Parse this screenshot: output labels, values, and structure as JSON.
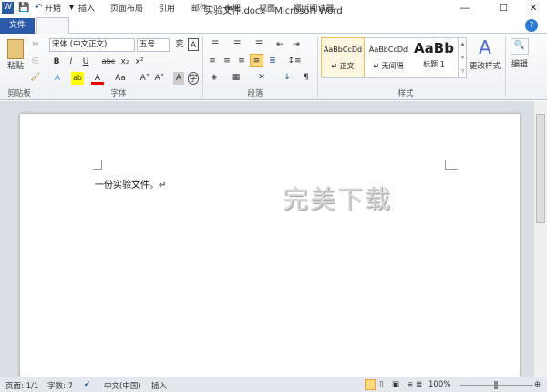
{
  "window": {
    "title": "实验文件.docx - Microsoft Word",
    "minimize": "—",
    "maximize": "☐",
    "close": "✕"
  },
  "quick_access": {
    "save": "💾",
    "undo": "↶",
    "redo": "↺",
    "customize": "▾"
  },
  "tabs": [
    {
      "label": "文件"
    },
    {
      "label": "开始"
    },
    {
      "label": "插入"
    },
    {
      "label": "页面布局"
    },
    {
      "label": "引用"
    },
    {
      "label": "邮件"
    },
    {
      "label": "审阅"
    },
    {
      "label": "视图"
    },
    {
      "label": "福昕阅读器"
    }
  ],
  "ribbon": {
    "clipboard": {
      "paste": "粘贴",
      "label": "剪贴板"
    },
    "font": {
      "name": "宋体 (中文正文)",
      "size": "五号",
      "label": "字体",
      "bold": "B",
      "italic": "I",
      "underline": "U",
      "strike": "abc",
      "sub": "x₂",
      "sup": "x²",
      "case": "Aa",
      "grow": "A˄",
      "shrink": "A˅"
    },
    "paragraph": {
      "label": "段落"
    },
    "styles": {
      "label": "样式",
      "items": [
        {
          "preview": "AaBbCcDd",
          "name": "↵ 正文"
        },
        {
          "preview": "AaBbCcDd",
          "name": "↵ 无间隔"
        },
        {
          "preview": "AaBb",
          "name": "标题 1"
        }
      ],
      "change": "更改样式"
    },
    "editing": {
      "label": "编辑"
    }
  },
  "document": {
    "text": "一份实验文件。↵",
    "watermark": "完美下载"
  },
  "status": {
    "page": "页面: 1/1",
    "words": "字数: 7",
    "language": "中文(中国)",
    "mode": "插入",
    "zoom": "100%"
  }
}
